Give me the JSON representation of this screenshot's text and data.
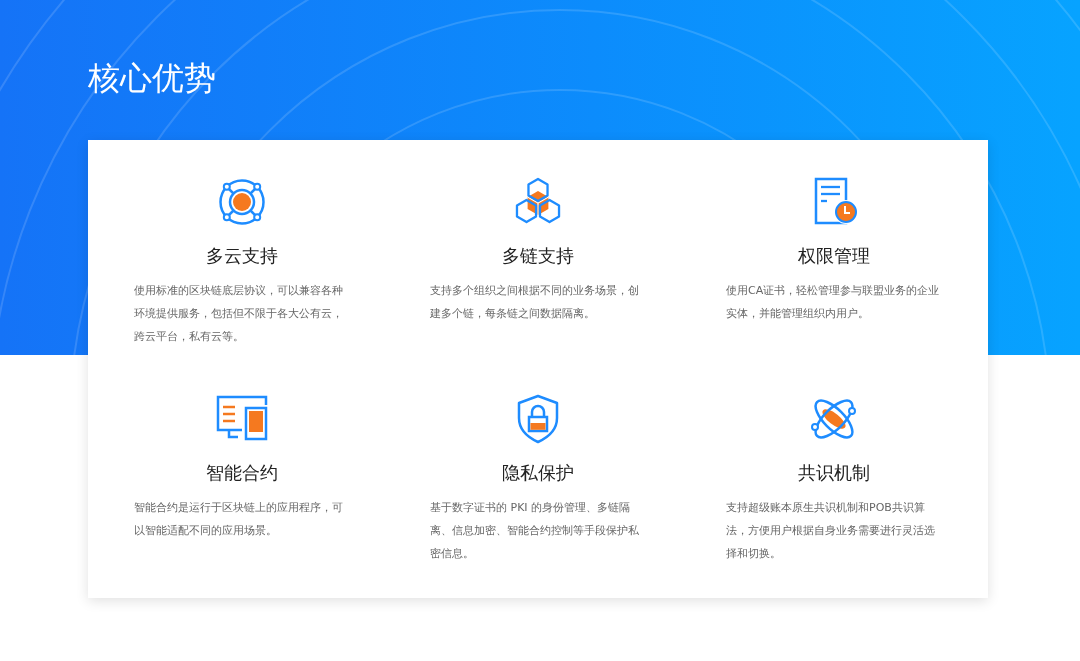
{
  "page": {
    "title": "核心优势"
  },
  "features": [
    {
      "kind": "lifebuoy",
      "title": "多云支持",
      "description": "使用标准的区块链底层协议，可以兼容各种环境提供服务，包括但不限于各大公有云，跨云平台，私有云等。"
    },
    {
      "kind": "hexagons",
      "title": "多链支持",
      "description": "支持多个组织之间根据不同的业务场景，创建多个链，每条链之间数据隔离。"
    },
    {
      "kind": "document",
      "title": "权限管理",
      "description": "使用CA证书，轻松管理参与联盟业务的企业实体，并能管理组织内用户。"
    },
    {
      "kind": "monitor",
      "title": "智能合约",
      "description": "智能合约是运行于区块链上的应用程序，可以智能适配不同的应用场景。"
    },
    {
      "kind": "shield",
      "title": "隐私保护",
      "description": "基于数字证书的 PKI 的身份管理、多链隔离、信息加密、智能合约控制等手段保护私密信息。"
    },
    {
      "kind": "atom",
      "title": "共识机制",
      "description": "支持超级账本原生共识机制和POB共识算法，方便用户根据自身业务需要进行灵活选择和切换。"
    }
  ]
}
